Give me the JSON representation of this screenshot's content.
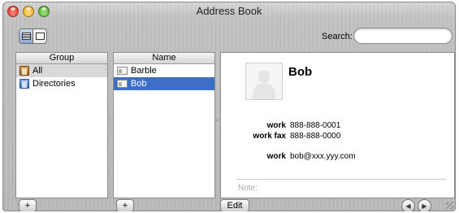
{
  "window": {
    "title": "Address Book"
  },
  "toolbar": {
    "search_label": "Search:",
    "search_value": ""
  },
  "group_column": {
    "header": "Group",
    "items": [
      {
        "label": "All"
      },
      {
        "label": "Directories"
      }
    ]
  },
  "name_column": {
    "header": "Name",
    "items": [
      {
        "label": "Barble"
      },
      {
        "label": "Bob"
      }
    ]
  },
  "card": {
    "name": "Bob",
    "phones": [
      {
        "label": "work",
        "value": "888-888-0001"
      },
      {
        "label": "work fax",
        "value": "888-888-0000"
      }
    ],
    "email": {
      "label": "work",
      "value": "bob@xxx.yyy.com"
    },
    "note_label": "Note:"
  },
  "bottom_bar": {
    "add_group": "+",
    "add_person": "+",
    "edit": "Edit",
    "prev": "◀",
    "next": "▶"
  }
}
